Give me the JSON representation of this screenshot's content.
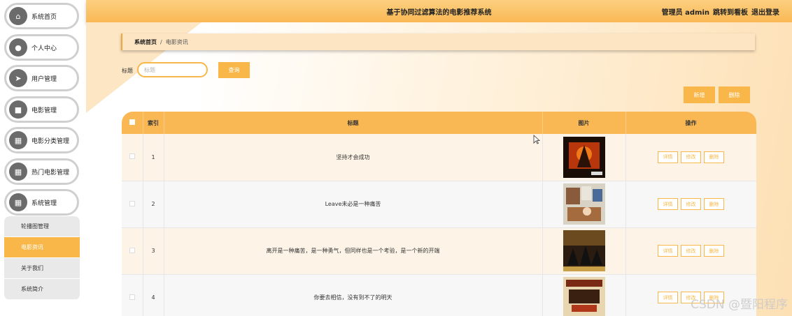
{
  "sidebar": {
    "items": [
      {
        "label": "系统首页",
        "icon": "home-icon"
      },
      {
        "label": "个人中心",
        "icon": "user-icon"
      },
      {
        "label": "用户管理",
        "icon": "send-icon"
      },
      {
        "label": "电影管理",
        "icon": "film-icon"
      },
      {
        "label": "电影分类管理",
        "icon": "grid-icon"
      },
      {
        "label": "热门电影管理",
        "icon": "grid-icon"
      },
      {
        "label": "系统管理",
        "icon": "grid-icon"
      }
    ],
    "submenu": [
      "轮播图管理",
      "电影资讯",
      "关于我们",
      "系统简介"
    ],
    "active_submenu": "电影资讯"
  },
  "header": {
    "title": "基于协同过滤算法的电影推荐系统",
    "user": "管理员 admin",
    "dashboard_link": "跳转到看板",
    "logout": "退出登录"
  },
  "breadcrumb": {
    "home": "系统首页",
    "sep": "/",
    "current": "电影资讯"
  },
  "search": {
    "label": "标题",
    "placeholder": "标题",
    "button": "查询"
  },
  "actions": {
    "add": "新增",
    "delete": "删除"
  },
  "table": {
    "headers": [
      "索引",
      "标题",
      "图片",
      "操作"
    ],
    "rows": [
      {
        "index": "1",
        "title": "坚持才会成功"
      },
      {
        "index": "2",
        "title": "Leave未必是一种痛苦"
      },
      {
        "index": "3",
        "title": "离开是一种痛苦，是一种勇气，但同样也是一个考验，是一个新的开端"
      },
      {
        "index": "4",
        "title": "你要去相信，没有到不了的明天"
      }
    ],
    "row_ops": [
      "详情",
      "修改",
      "删除"
    ]
  },
  "watermark": "CSDN @暨阳程序",
  "colors": {
    "accent": "#f8b748",
    "header": "#f9b854"
  }
}
